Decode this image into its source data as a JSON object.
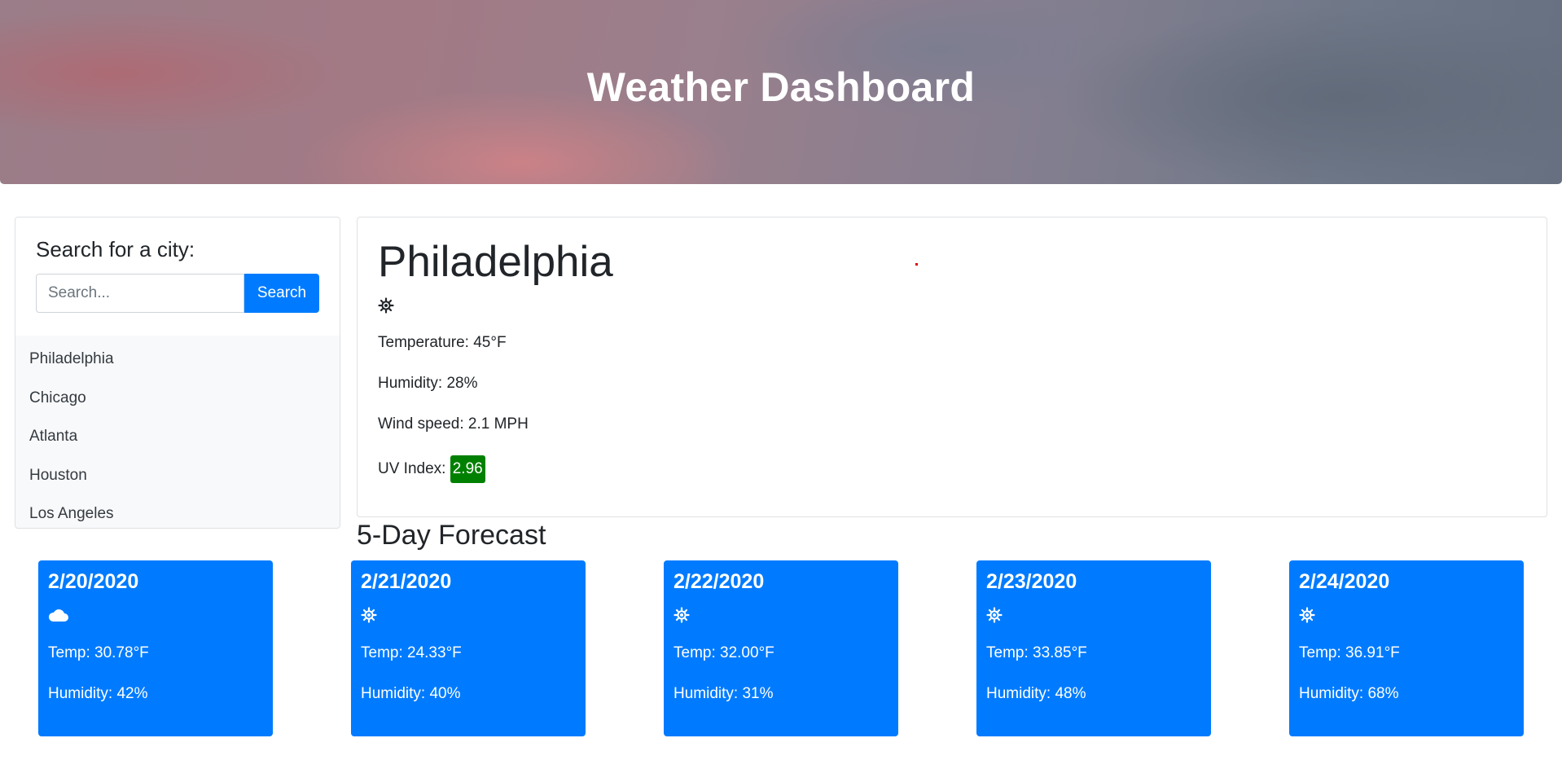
{
  "header": {
    "title": "Weather Dashboard"
  },
  "search": {
    "heading": "Search for a city:",
    "placeholder": "Search...",
    "value": "",
    "button_label": "Search"
  },
  "cities": [
    "Philadelphia",
    "Chicago",
    "Atlanta",
    "Houston",
    "Los Angeles"
  ],
  "current": {
    "city": "Philadelphia",
    "icon": "sun-icon",
    "temperature": "Temperature: 45°F",
    "humidity": "Humidity: 28%",
    "wind": "Wind speed: 2.1 MPH",
    "uv_label": "UV Index:",
    "uv_value": "2.96",
    "uv_color": "#008000"
  },
  "forecast": {
    "title": "5-Day Forecast",
    "days": [
      {
        "date": "2/20/2020",
        "icon": "cloud-icon",
        "temp": "Temp: 30.78°F",
        "humidity": "Humidity: 42%"
      },
      {
        "date": "2/21/2020",
        "icon": "sun-icon",
        "temp": "Temp: 24.33°F",
        "humidity": "Humidity: 40%"
      },
      {
        "date": "2/22/2020",
        "icon": "sun-icon",
        "temp": "Temp: 32.00°F",
        "humidity": "Humidity: 31%"
      },
      {
        "date": "2/23/2020",
        "icon": "sun-icon",
        "temp": "Temp: 33.85°F",
        "humidity": "Humidity: 48%"
      },
      {
        "date": "2/24/2020",
        "icon": "sun-icon",
        "temp": "Temp: 36.91°F",
        "humidity": "Humidity: 68%"
      }
    ]
  },
  "colors": {
    "accent": "#007bff",
    "uv_low": "#008000"
  }
}
